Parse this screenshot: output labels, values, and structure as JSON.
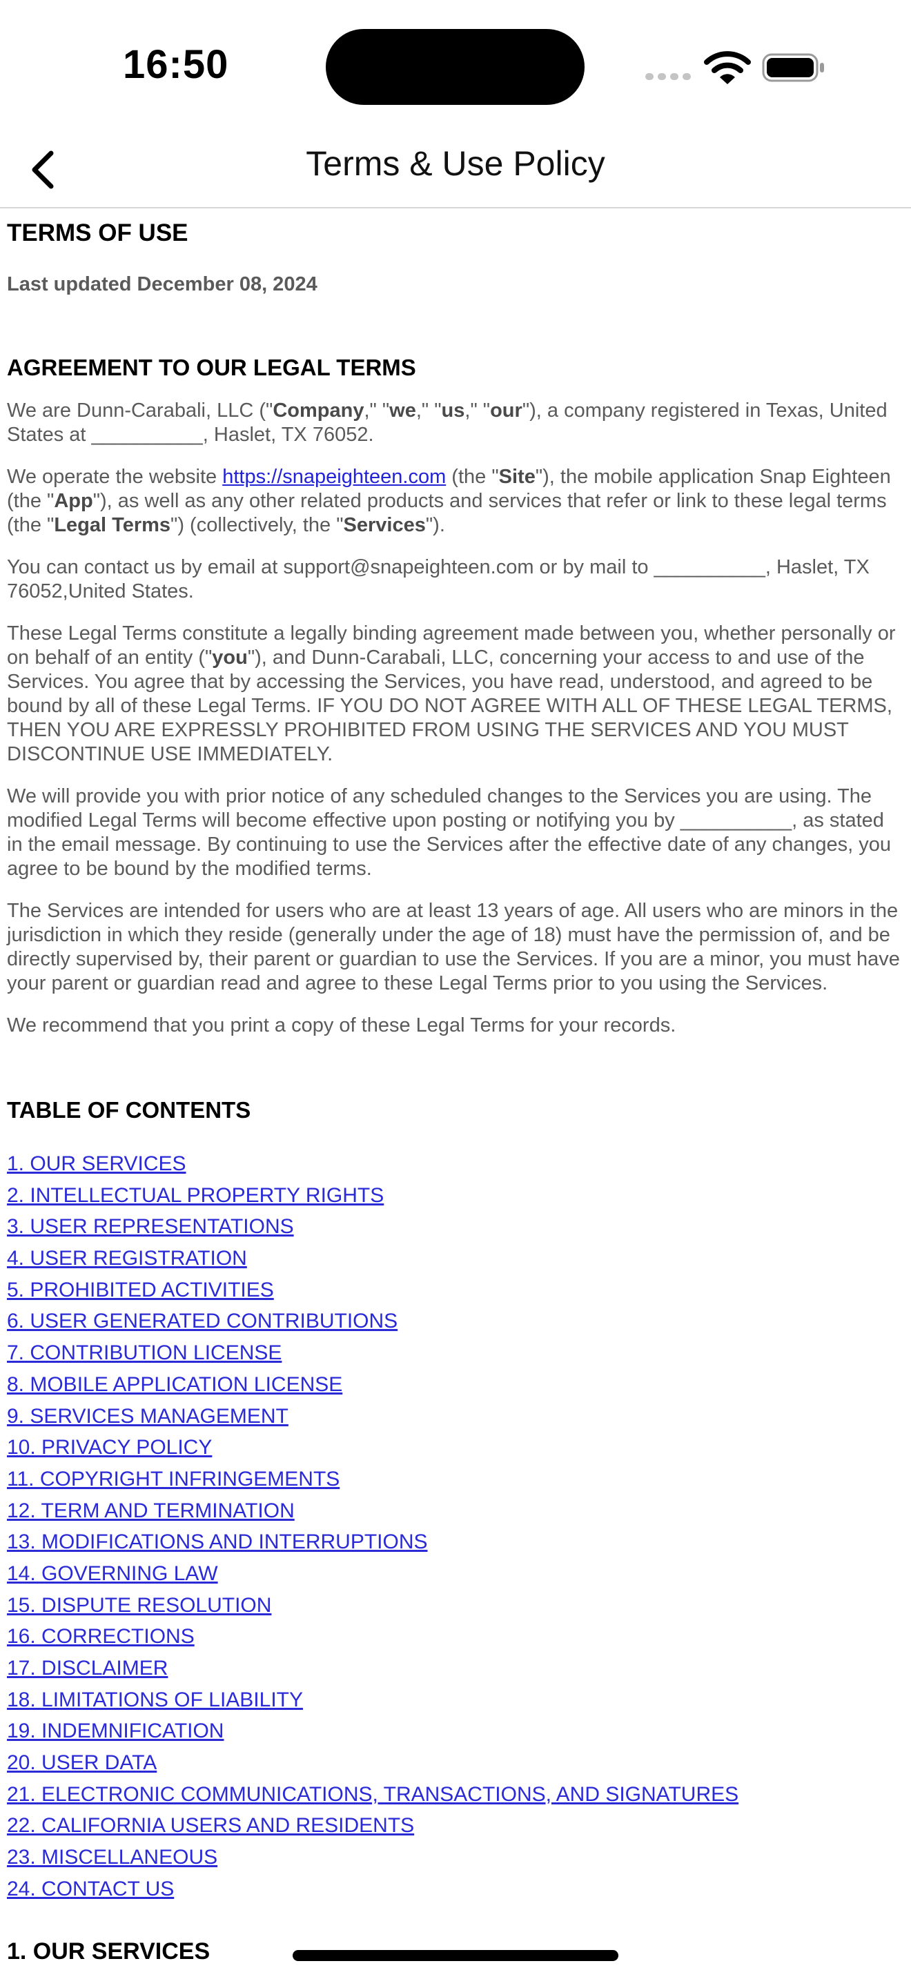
{
  "status_bar": {
    "time": "16:50"
  },
  "nav": {
    "title": "Terms & Use Policy"
  },
  "doc": {
    "heading": "TERMS OF USE",
    "last_updated": "Last updated December 08, 2024",
    "agreement_heading": "AGREEMENT TO OUR LEGAL TERMS",
    "p1": {
      "a": "We are Dunn-Carabali, LLC (\"",
      "company": "Company",
      "b": ",\" \"",
      "we": "we",
      "c": ",\" \"",
      "us": "us",
      "d": ",\" \"",
      "our": "our",
      "e": "\"), a company registered in Texas, United States at __________, Haslet, TX 76052."
    },
    "p2": {
      "a": "We operate the website ",
      "link": "https://snapeighteen.com",
      "b": " (the \"",
      "site": "Site",
      "c": "\"), the mobile application Snap Eighteen (the \"",
      "app": "App",
      "d": "\"), as well as any other related products and services that refer or link to these legal terms (the \"",
      "legal_terms": "Legal Terms",
      "e": "\") (collectively, the \"",
      "services": "Services",
      "f": "\")."
    },
    "p3": "You can contact us by email at support@snapeighteen.com or by mail to __________, Haslet, TX 76052,United States.",
    "p4": {
      "a": "These Legal Terms constitute a legally binding agreement made between you, whether personally or on behalf of an entity (\"",
      "you": "you",
      "b": "\"), and Dunn-Carabali, LLC, concerning your access to and use of the Services. You agree that by accessing the Services, you have read, understood, and agreed to be bound by all of these Legal Terms. IF YOU DO NOT AGREE WITH ALL OF THESE LEGAL TERMS, THEN YOU ARE EXPRESSLY PROHIBITED FROM USING THE SERVICES AND YOU MUST DISCONTINUE USE IMMEDIATELY."
    },
    "p5": "We will provide you with prior notice of any scheduled changes to the Services you are using. The modified Legal Terms will become effective upon posting or notifying you by __________, as stated in the email message. By continuing to use the Services after the effective date of any changes, you agree to be bound by the modified terms.",
    "p6": "The Services are intended for users who are at least 13 years of age. All users who are minors in the jurisdiction in which they reside (generally under the age of 18) must have the permission of, and be directly supervised by, their parent or guardian to use the Services. If you are a minor, you must have your parent or guardian read and agree to these Legal Terms prior to you using the Services.",
    "p7": "We recommend that you print a copy of these Legal Terms for your records.",
    "toc_heading": "TABLE OF CONTENTS",
    "toc": [
      "1. OUR SERVICES",
      "2. INTELLECTUAL PROPERTY RIGHTS",
      "3. USER REPRESENTATIONS",
      "4. USER REGISTRATION",
      "5. PROHIBITED ACTIVITIES",
      "6. USER GENERATED CONTRIBUTIONS",
      "7. CONTRIBUTION LICENSE",
      "8. MOBILE APPLICATION LICENSE",
      "9. SERVICES MANAGEMENT",
      "10. PRIVACY POLICY",
      "11. COPYRIGHT INFRINGEMENTS",
      "12. TERM AND TERMINATION",
      "13. MODIFICATIONS AND INTERRUPTIONS",
      "14. GOVERNING LAW",
      "15. DISPUTE RESOLUTION",
      "16. CORRECTIONS",
      "17. DISCLAIMER",
      "18. LIMITATIONS OF LIABILITY",
      "19. INDEMNIFICATION",
      "20. USER DATA",
      "21. ELECTRONIC COMMUNICATIONS, TRANSACTIONS, AND SIGNATURES",
      "22. CALIFORNIA USERS AND RESIDENTS",
      "23. MISCELLANEOUS",
      "24. CONTACT US"
    ],
    "next_heading": "1. OUR SERVICES"
  },
  "colors": {
    "link": "#2a2ad6",
    "body_text": "#5a5a5a",
    "heading": "#000000"
  },
  "icons": {
    "back": "chevron-left-icon",
    "wifi": "wifi-icon",
    "battery": "battery-icon",
    "cellular": "cellular-icon"
  }
}
